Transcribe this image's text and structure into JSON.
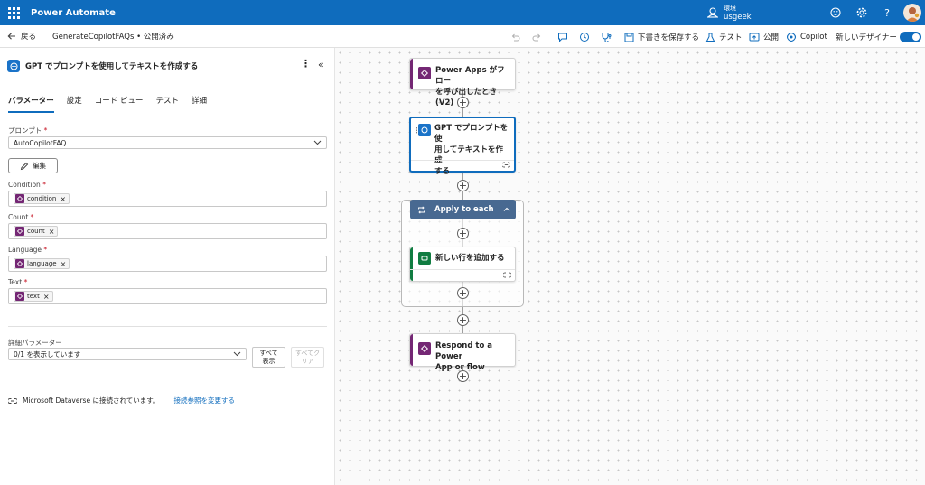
{
  "topbar": {
    "app_name": "Power Automate",
    "env_label": "環境",
    "env_value": "usgeek",
    "icons": [
      "waffle-icon",
      "environment-icon",
      "smiley-icon",
      "gear-icon",
      "help-icon",
      "avatar"
    ]
  },
  "cmdbar": {
    "back": "戻る",
    "flow_name": "GenerateCopilotFAQs • 公開済み",
    "save_draft": "下書きを保存する",
    "test": "テスト",
    "publish": "公開",
    "copilot": "Copilot",
    "new_designer": "新しいデザイナー"
  },
  "panel": {
    "title": "GPT でプロンプトを使用してテキストを作成する",
    "tabs": [
      "パラメーター",
      "設定",
      "コード ビュー",
      "テスト",
      "詳細"
    ],
    "prompt_label": "プロンプト",
    "prompt_value": "AutoCopilotFAQ",
    "edit_button": "編集",
    "fields": [
      {
        "label": "Condition",
        "token": "condition"
      },
      {
        "label": "Count",
        "token": "count"
      },
      {
        "label": "Language",
        "token": "language"
      },
      {
        "label": "Text",
        "token": "text"
      }
    ],
    "required_mark": "*",
    "advanced_label": "詳細パラメーター",
    "advanced_value": "0/1 を表示しています",
    "show_all_1": "すべて",
    "show_all_2": "表示",
    "clear_all_1": "すべてク",
    "clear_all_2": "リア",
    "connection_text": "Microsoft Dataverse に接続されています。",
    "change_connection": "接続参照を変更する"
  },
  "canvas": {
    "trigger_line1": "Power Apps がフロー",
    "trigger_line2": "を呼び出したとき (V2)",
    "gpt_line1": "GPT でプロンプトを使",
    "gpt_line2": "用してテキストを作成",
    "gpt_line3": "する",
    "loop_title": "Apply to each",
    "add_row": "新しい行を追加する",
    "respond_line1": "Respond to a Power",
    "respond_line2": "App or flow"
  },
  "colors": {
    "brand": "#0f6cbd",
    "power_apps": "#742774",
    "ai_builder": "#1a73c8",
    "dataverse": "#107c41",
    "loop_header": "#486991"
  }
}
